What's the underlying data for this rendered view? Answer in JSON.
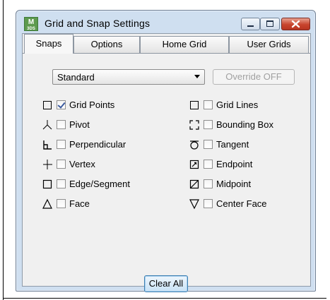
{
  "window": {
    "title": "Grid and Snap Settings",
    "app_icon": "max-3ds-icon",
    "app_icon_top_text": "M",
    "app_icon_bottom_text": "3DS"
  },
  "tabs": [
    "Snaps",
    "Options",
    "Home Grid",
    "User Grids"
  ],
  "active_tab": "Snaps",
  "preset_dropdown": {
    "selected": "Standard"
  },
  "override_button": "Override OFF",
  "snap_left": [
    {
      "label": "Grid Points",
      "icon": "grid-points-icon",
      "checked": true
    },
    {
      "label": "Pivot",
      "icon": "pivot-icon",
      "checked": false
    },
    {
      "label": "Perpendicular",
      "icon": "perpendicular-icon",
      "checked": false
    },
    {
      "label": "Vertex",
      "icon": "vertex-icon",
      "checked": false
    },
    {
      "label": "Edge/Segment",
      "icon": "edge-segment-icon",
      "checked": false
    },
    {
      "label": "Face",
      "icon": "face-icon",
      "checked": false
    }
  ],
  "snap_right": [
    {
      "label": "Grid Lines",
      "icon": "grid-lines-icon",
      "checked": false
    },
    {
      "label": "Bounding Box",
      "icon": "bounding-box-icon",
      "checked": false
    },
    {
      "label": "Tangent",
      "icon": "tangent-icon",
      "checked": false
    },
    {
      "label": "Endpoint",
      "icon": "endpoint-icon",
      "checked": false
    },
    {
      "label": "Midpoint",
      "icon": "midpoint-icon",
      "checked": false
    },
    {
      "label": "Center Face",
      "icon": "center-face-icon",
      "checked": false
    }
  ],
  "clear_all_button": "Clear All"
}
